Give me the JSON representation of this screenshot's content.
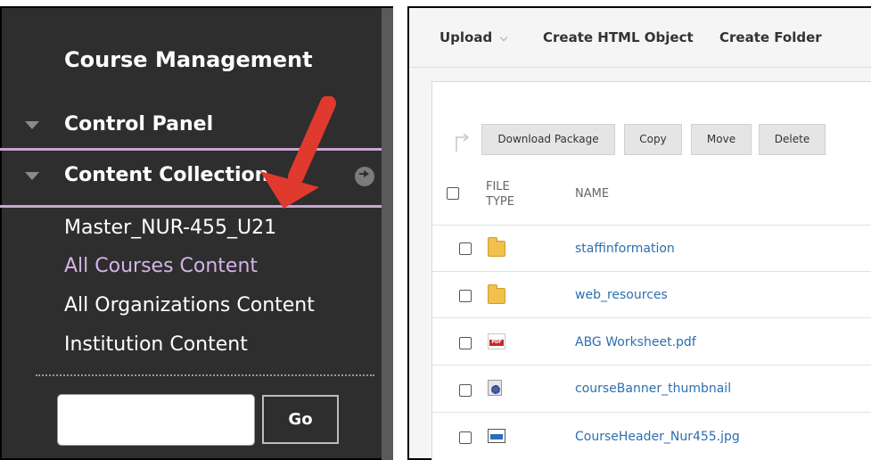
{
  "left_panel": {
    "title": "Course Management",
    "sections": {
      "control_panel": "Control Panel",
      "content_collection": "Content Collection"
    },
    "links": [
      {
        "label": "Master_NUR-455_U21"
      },
      {
        "label": "All Courses Content"
      },
      {
        "label": "All Organizations Content"
      },
      {
        "label": "Institution Content"
      }
    ],
    "search": {
      "value": "",
      "button_label": "Go"
    },
    "annotation_arrow_color": "#e03a2f"
  },
  "toolbar": {
    "upload_label": "Upload",
    "create_html_label": "Create HTML Object",
    "create_folder_label": "Create Folder"
  },
  "actions": {
    "download_package": "Download Package",
    "copy": "Copy",
    "move": "Move",
    "delete": "Delete"
  },
  "table": {
    "header_filetype": "FILE\nTYPE",
    "header_name": "NAME",
    "rows": [
      {
        "icon": "folder-icon",
        "name": "staffinformation"
      },
      {
        "icon": "folder-icon",
        "name": "web_resources"
      },
      {
        "icon": "pdf-icon",
        "name": "ABG Worksheet.pdf"
      },
      {
        "icon": "gear-file-icon",
        "name": "courseBanner_thumbnail"
      },
      {
        "icon": "image-file-icon",
        "name": "CourseHeader_Nur455.jpg"
      }
    ]
  },
  "colors": {
    "panel_bg": "#2e2e2e",
    "accent_separator": "#c7a6cf",
    "link_blue": "#2c6fb0",
    "visited_purple": "#d4b4e8"
  }
}
